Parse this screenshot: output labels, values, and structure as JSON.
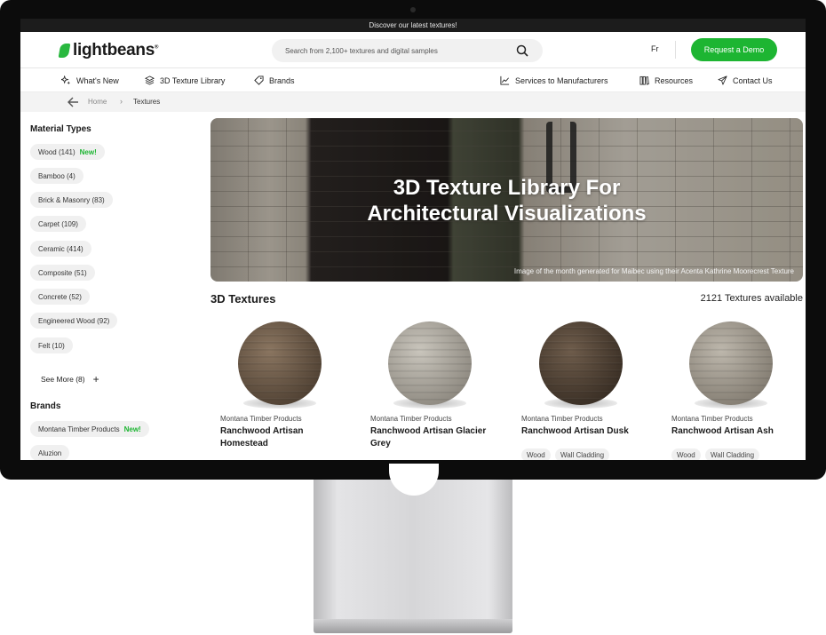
{
  "announcement": "Discover our latest textures!",
  "header": {
    "logo": "lightbeans",
    "logo_mark": "®",
    "search_placeholder": "Search from 2,100+ textures and digital samples",
    "lang": "Fr",
    "demo_button": "Request a Demo"
  },
  "nav": {
    "whats_new": "What's New",
    "library": "3D Texture Library",
    "brands": "Brands",
    "services": "Services to Manufacturers",
    "resources": "Resources",
    "contact": "Contact Us"
  },
  "breadcrumb": {
    "home": "Home",
    "sep": "›",
    "current": "Textures"
  },
  "sidebar": {
    "material_title": "Material Types",
    "materials": [
      {
        "label": "Wood (141)",
        "badge": "New!"
      },
      {
        "label": "Bamboo (4)"
      },
      {
        "label": "Brick & Masonry (83)"
      },
      {
        "label": "Carpet (109)"
      },
      {
        "label": "Ceramic (414)"
      },
      {
        "label": "Composite (51)"
      },
      {
        "label": "Concrete (52)"
      },
      {
        "label": "Engineered Wood (92)"
      },
      {
        "label": "Felt (10)"
      }
    ],
    "see_more": "See More (8)",
    "brands_title": "Brands",
    "brands": [
      {
        "label": "Montana Timber Products",
        "badge": "New!"
      },
      {
        "label": "Aluzion"
      }
    ]
  },
  "hero": {
    "title_line1": "3D Texture Library For",
    "title_line2": "Architectural Visualizations",
    "caption": "Image of the month generated for Maibec using their Acenta Kathrine Moorecrest Texture"
  },
  "section": {
    "title": "3D Textures",
    "count": "2121 Textures available"
  },
  "cards": [
    {
      "maker": "Montana Timber Products",
      "name": "Ranchwood Artisan Homestead",
      "tags": [],
      "color_a": "#8a7560",
      "color_b": "#3f3226"
    },
    {
      "maker": "Montana Timber Products",
      "name": "Ranchwood Artisan Glacier Grey",
      "tags": [],
      "color_a": "#c9c5bc",
      "color_b": "#7d786f"
    },
    {
      "maker": "Montana Timber Products",
      "name": "Ranchwood Artisan Dusk",
      "tags": [
        "Wood",
        "Wall Cladding"
      ],
      "color_a": "#6e5c4b",
      "color_b": "#2a2119"
    },
    {
      "maker": "Montana Timber Products",
      "name": "Ranchwood Artisan Ash",
      "tags": [
        "Wood",
        "Wall Cladding"
      ],
      "color_a": "#bdb7ac",
      "color_b": "#736c61"
    }
  ],
  "colors": {
    "brand_green": "#1db532",
    "dark": "#1a1a1a"
  }
}
